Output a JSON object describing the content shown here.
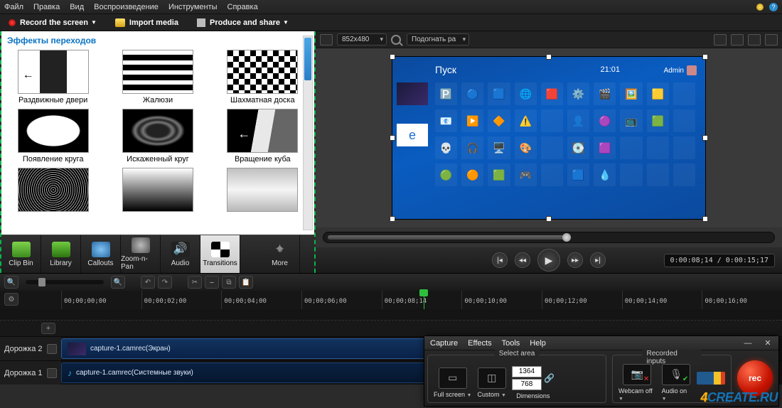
{
  "menu": {
    "items": [
      "Файл",
      "Правка",
      "Вид",
      "Воспроизведение",
      "Инструменты",
      "Справка"
    ]
  },
  "actions": {
    "record": "Record the screen",
    "import": "Import media",
    "produce": "Produce and share"
  },
  "transitions": {
    "title": "Эффекты переходов",
    "items": [
      "Раздвижные двери",
      "Жалюзи",
      "Шахматная доска",
      "Появление круга",
      "Искаженный круг",
      "Вращение куба",
      "",
      "",
      ""
    ]
  },
  "tabs": {
    "clipbin": "Clip Bin",
    "library": "Library",
    "callouts": "Callouts",
    "zoom": "Zoom-n-Pan",
    "audio": "Audio",
    "transitions": "Transitions",
    "more": "More"
  },
  "preview": {
    "res": "852x480",
    "fit": "Подогнать ра",
    "start": "Пуск",
    "clock": "21:01",
    "user": "Admin",
    "timecode": "0:00:08;14 / 0:00:15;17"
  },
  "timeline": {
    "ticks": [
      "00;00;00;00",
      "00;00;02;00",
      "00;00;04;00",
      "00;00;06;00",
      "00;00;08;14",
      "00;00;10;00",
      "00;00;12;00",
      "00;00;14;00",
      "00;00;16;00"
    ],
    "track2": "Дорожка 2",
    "track1": "Дорожка 1",
    "clip_video": "capture-1.camrec(Экран)",
    "clip_audio": "capture-1.camrec(Системные звуки)"
  },
  "recorder": {
    "menu": [
      "Capture",
      "Effects",
      "Tools",
      "Help"
    ],
    "select_area": "Select area",
    "recorded_inputs": "Recorded inputs",
    "full": "Full screen",
    "custom": "Custom",
    "dimensions": "Dimensions",
    "w": "1364",
    "h": "768",
    "webcam": "Webcam off",
    "audio": "Audio on",
    "rec": "rec"
  },
  "watermark": {
    "num": "4",
    "txt": "CREATE.RU"
  },
  "tile_emoji": [
    "🅿️",
    "🔵",
    "🟦",
    "🌐",
    "🟥",
    "⚙️",
    "🎬",
    "🖼️",
    "🟨",
    "",
    "📧",
    "▶️",
    "🔶",
    "⚠️",
    "",
    "👤",
    "🟣",
    "📺",
    "🟩",
    "",
    "💀",
    "🎧",
    "🖥️",
    "🎨",
    "",
    "💽",
    "🟪",
    "",
    "",
    "",
    "🟢",
    "🟠",
    "🟩",
    "🎮",
    "",
    "🟦",
    "💧",
    "",
    "",
    ""
  ]
}
